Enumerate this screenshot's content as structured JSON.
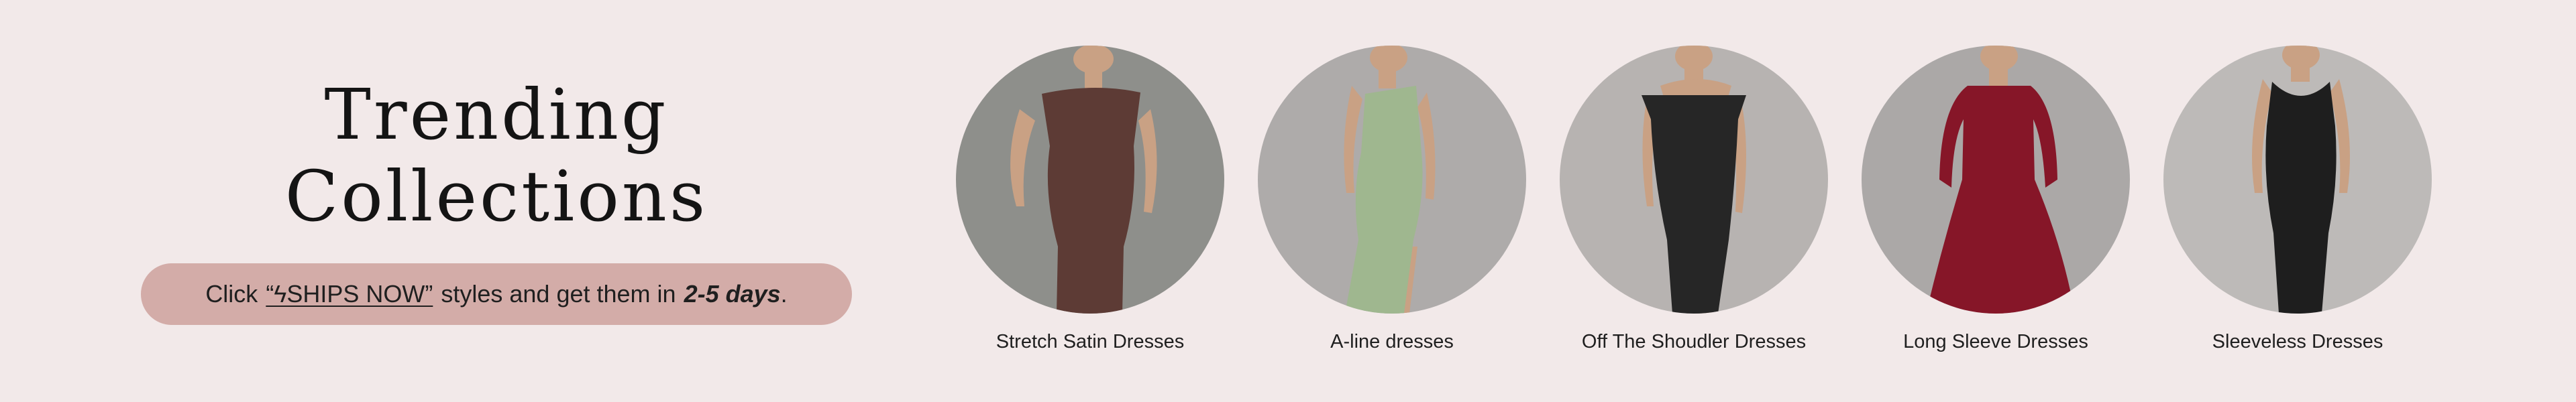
{
  "hero": {
    "title_line1": "Trending",
    "title_line2": "Collections",
    "promo": {
      "prefix": "Click",
      "link_text": "“ϟSHIPS NOW”",
      "middle": "styles and get them in",
      "days": "2-5 days",
      "suffix": "."
    }
  },
  "collections": [
    {
      "label": "Stretch Satin Dresses",
      "dress_color": "#5d3b35",
      "bg_color": "#8e8f8b",
      "icon": "dress-image"
    },
    {
      "label": "A-line dresses",
      "dress_color": "#9fb78f",
      "bg_color": "#aeabaa",
      "icon": "dress-image"
    },
    {
      "label": "Off The Shoudler Dresses",
      "dress_color": "#262626",
      "bg_color": "#b7b3b1",
      "icon": "dress-image"
    },
    {
      "label": "Long Sleeve Dresses",
      "dress_color": "#861628",
      "bg_color": "#aba8a7",
      "icon": "dress-image"
    },
    {
      "label": "Sleeveless Dresses",
      "dress_color": "#1e1e1e",
      "bg_color": "#bdbab8",
      "icon": "dress-image"
    }
  ],
  "colors": {
    "page_bg": "#f2e9e9",
    "pill_bg": "#d3aca8",
    "text": "#1a1a1a",
    "skin": "#c9a184"
  }
}
